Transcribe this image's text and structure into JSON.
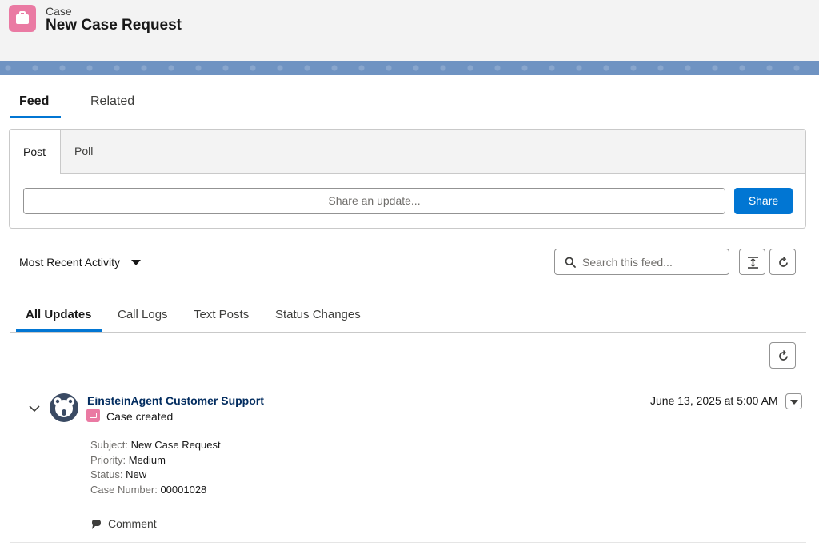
{
  "header": {
    "object_type": "Case",
    "record_title": "New Case Request",
    "object_icon": "briefcase-icon",
    "accent_color": "#ea7aa3"
  },
  "main_tabs": [
    {
      "label": "Feed",
      "active": true
    },
    {
      "label": "Related",
      "active": false
    }
  ],
  "publisher": {
    "tabs": [
      {
        "label": "Post",
        "active": true
      },
      {
        "label": "Poll",
        "active": false
      }
    ],
    "input_placeholder": "Share an update...",
    "share_label": "Share",
    "share_color": "#0176d3"
  },
  "feed_controls": {
    "sort_label": "Most Recent Activity",
    "search_placeholder": "Search this feed...",
    "expand_icon": "expand-collapse-icon",
    "refresh_icon": "refresh-icon"
  },
  "filter_tabs": [
    {
      "label": "All Updates",
      "active": true
    },
    {
      "label": "Call Logs",
      "active": false
    },
    {
      "label": "Text Posts",
      "active": false
    },
    {
      "label": "Status Changes",
      "active": false
    }
  ],
  "feed_item": {
    "author": "EinsteinAgent Customer Support",
    "action": "Case created",
    "timestamp": "June 13, 2025 at 5:00 AM",
    "details": [
      {
        "label": "Subject",
        "value": "New Case Request"
      },
      {
        "label": "Priority",
        "value": "Medium"
      },
      {
        "label": "Status",
        "value": "New"
      },
      {
        "label": "Case Number",
        "value": "00001028"
      }
    ],
    "comment_label": "Comment"
  }
}
